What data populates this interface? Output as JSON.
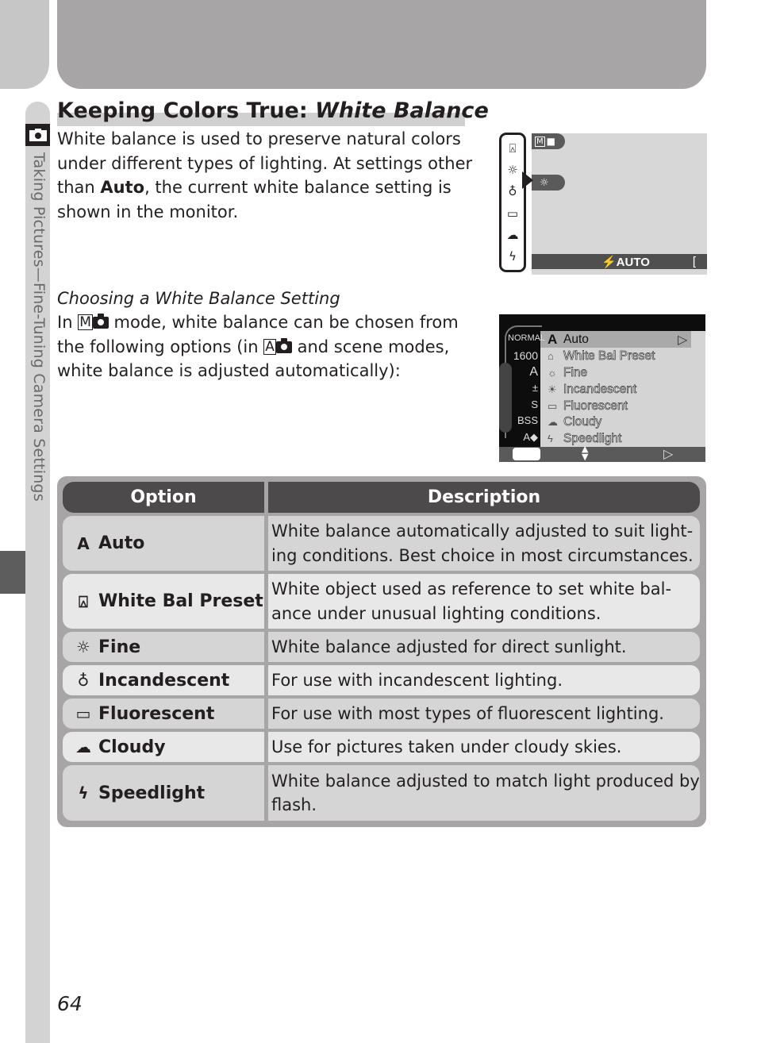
{
  "page": {
    "section_label": "Taking Pictures—Fine-Tuning Camera Settings",
    "page_number": "64",
    "title_plain": "Keeping Colors True: ",
    "title_italic": "White Balance"
  },
  "intro": {
    "text_before": "White balance is used to preserve natural colors under different types of lighting.  At settings other than ",
    "bold": "Auto",
    "text_after": ", the current white balance setting is shown in the monitor."
  },
  "choosing": {
    "subheading": "Choosing a White Balance Setting",
    "part1": "In ",
    "mode1": "M",
    "part2": " mode, white balance can be chosen from the following options (in ",
    "mode2": "A",
    "part3": " and scene modes, white balance is adjusted automatically):"
  },
  "monitor1": {
    "mode_badge": "M",
    "current_wb_icon": "fine-icon",
    "flash_label": "⚡AUTO",
    "bracket": "[",
    "strip_icons": [
      "preset-icon",
      "fine-icon",
      "incandescent-icon",
      "fluorescent-icon",
      "cloudy-icon",
      "speedlight-icon"
    ]
  },
  "monitor2": {
    "left_labels": [
      "NORMAL",
      "1600",
      "A",
      "±",
      "S",
      "BSS",
      "A◆"
    ],
    "menu_items": [
      {
        "icon": "A",
        "label": "Auto",
        "selected": true
      },
      {
        "icon": "⌂",
        "label": "White Bal Preset"
      },
      {
        "icon": "☼",
        "label": "Fine"
      },
      {
        "icon": "☀",
        "label": "Incandescent"
      },
      {
        "icon": "▭",
        "label": "Fluorescent"
      },
      {
        "icon": "☁",
        "label": "Cloudy"
      },
      {
        "icon": "ϟ",
        "label": "Speedlight"
      }
    ],
    "right_arrow": "▷",
    "updown": "▲▼"
  },
  "table": {
    "headers": [
      "Option",
      "Description"
    ],
    "rows": [
      {
        "icon": "A",
        "option": "Auto",
        "description": "White balance automatically adjusted to suit light-ing conditions.  Best choice in most circumstances."
      },
      {
        "icon": "⍓",
        "option": "White Bal Preset",
        "description": "White object used as reference to set white bal-ance under unusual lighting conditions."
      },
      {
        "icon": "☼",
        "option": "Fine",
        "description": "White balance adjusted for direct sunlight."
      },
      {
        "icon": "♁",
        "option": "Incandescent",
        "description": "For use with incandescent lighting."
      },
      {
        "icon": "▭",
        "option": "Fluorescent",
        "description": "For use with most types of fluorescent lighting."
      },
      {
        "icon": "☁",
        "option": "Cloudy",
        "description": "Use for pictures taken under cloudy skies."
      },
      {
        "icon": "ϟ",
        "option": "Speedlight",
        "description": "White balance adjusted to match light produced by flash."
      }
    ]
  }
}
